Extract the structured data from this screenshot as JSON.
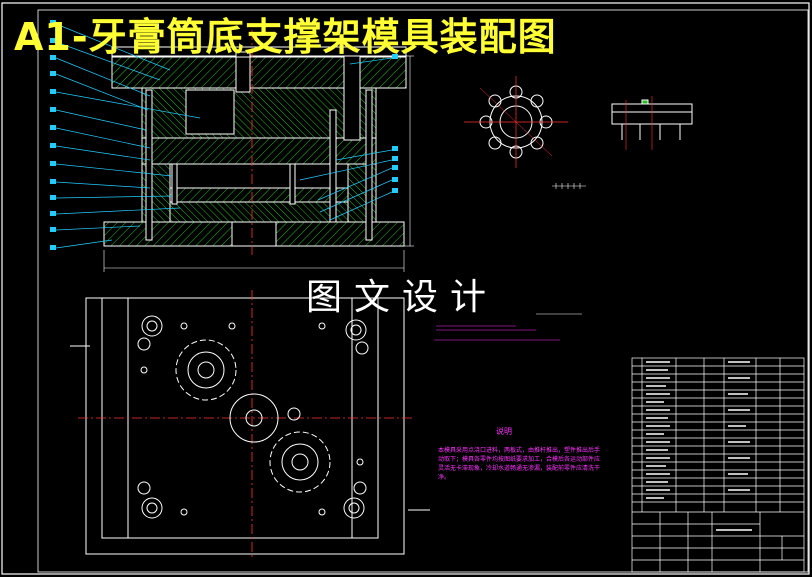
{
  "drawing": {
    "title": "A1-牙膏筒底支撑架模具装配图",
    "watermark": "图文设计",
    "notes_title": "说明",
    "notes_body": "本模具采用点浇口进料，两板式，由推杆推出，塑件推出后手动取下；模具各零件均按图纸要求加工，合模后各运动部件应灵活无卡滞现象，冷却水道畅通无渗漏，装配前零件应清洗干净。"
  },
  "colors": {
    "background": "#000000",
    "outline": "#ffffff",
    "hatch": "#22bb22",
    "centerline": "#ff3333",
    "leader": "#22ccff",
    "title": "#ffff33",
    "notes": "#ff33ff"
  }
}
